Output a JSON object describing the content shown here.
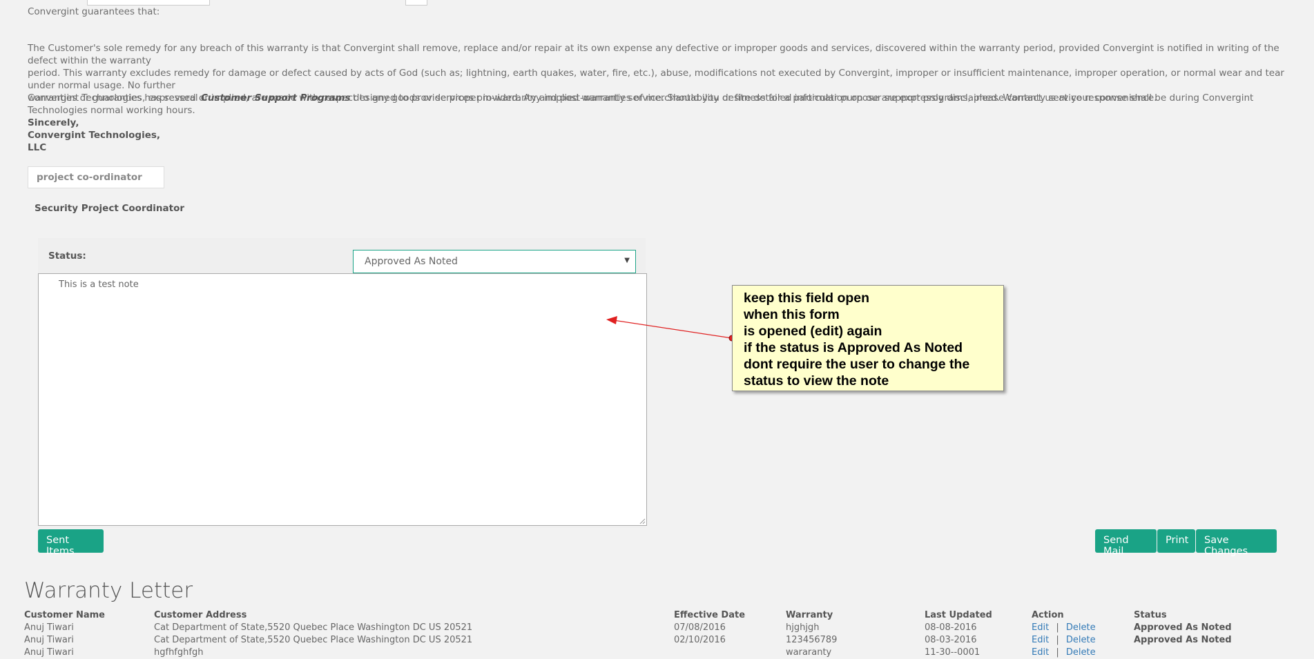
{
  "letter": {
    "guarantee_line": "Convergint guarantees that:",
    "remedy_paragraph_lines": [
      "The Customer's sole remedy for any breach of this warranty is that Convergint shall remove, replace and/or repair at its own expense any defective or improper goods and services, discovered within the warranty period, provided Convergint is notified in writing of the defect within the warranty",
      "period. This warranty excludes remedy for damage or defect caused by acts of God (such as; lightning, earth quakes, water, fire, etc.), abuse, modifications not executed by Convergint, improper or insufficient maintenance, improper operation, or normal wear and tear under normal usage. No further",
      "warranties or guaranties, expressed or implied, are made with respect to any goods or services provided. Any implied warranties of merchantability or fitness for a particular purpose are expressly disclaimed. Warranty service response shall be during Convergint Technologies normal working hours."
    ],
    "support_pre": "Convergint Technologies has several ",
    "support_bold": "Customer Support Programs",
    "support_post": " designed to provide proper in-warranty and post-warranty service. Should you desire detailed information on our support programs, please contact us at your convenience.",
    "sign_lines": [
      "Sincerely,",
      "Convergint Technologies,",
      "LLC"
    ],
    "coordinator_placeholder": "project co-ordinator",
    "coordinator_title": "Security Project Coordinator"
  },
  "status_form": {
    "label": "Status:",
    "selected": "Approved As Noted",
    "note_text": "This is a test note"
  },
  "buttons": {
    "sent_items": "Sent Items",
    "send_mail": "Send Mail",
    "print": "Print",
    "save_changes": "Save Changes"
  },
  "callout": {
    "lines": [
      "keep this field open",
      "when this form",
      "is opened (edit) again",
      "if the status is Approved As Noted",
      "dont require the user to change the",
      "status to view the note"
    ]
  },
  "warranty_table": {
    "title": "Warranty Letter",
    "headers": [
      "Customer Name",
      "Customer Address",
      "Effective Date",
      "Warranty",
      "Last Updated",
      "Action",
      "Status"
    ],
    "action_edit": "Edit",
    "action_sep": "|",
    "action_delete": "Delete",
    "rows": [
      {
        "name": "Anuj Tiwari",
        "address": "Cat Department of State,5520 Quebec Place Washington DC US 20521",
        "effective": "07/08/2016",
        "warranty": "hjghjgh",
        "updated": "08-08-2016",
        "status": "Approved As Noted"
      },
      {
        "name": "Anuj Tiwari",
        "address": "Cat Department of State,5520 Quebec Place Washington DC US 20521",
        "effective": "02/10/2016",
        "warranty": "123456789",
        "updated": "08-03-2016",
        "status": "Approved As Noted"
      },
      {
        "name": "Anuj Tiwari",
        "address": "hgfhfghfgh",
        "effective": "",
        "warranty": "wararanty",
        "updated": "11-30--0001",
        "status": ""
      }
    ]
  },
  "colors": {
    "accent": "#1aa386",
    "callout_bg": "#ffffcc",
    "arrow": "#e02020",
    "link": "#337ab7"
  }
}
